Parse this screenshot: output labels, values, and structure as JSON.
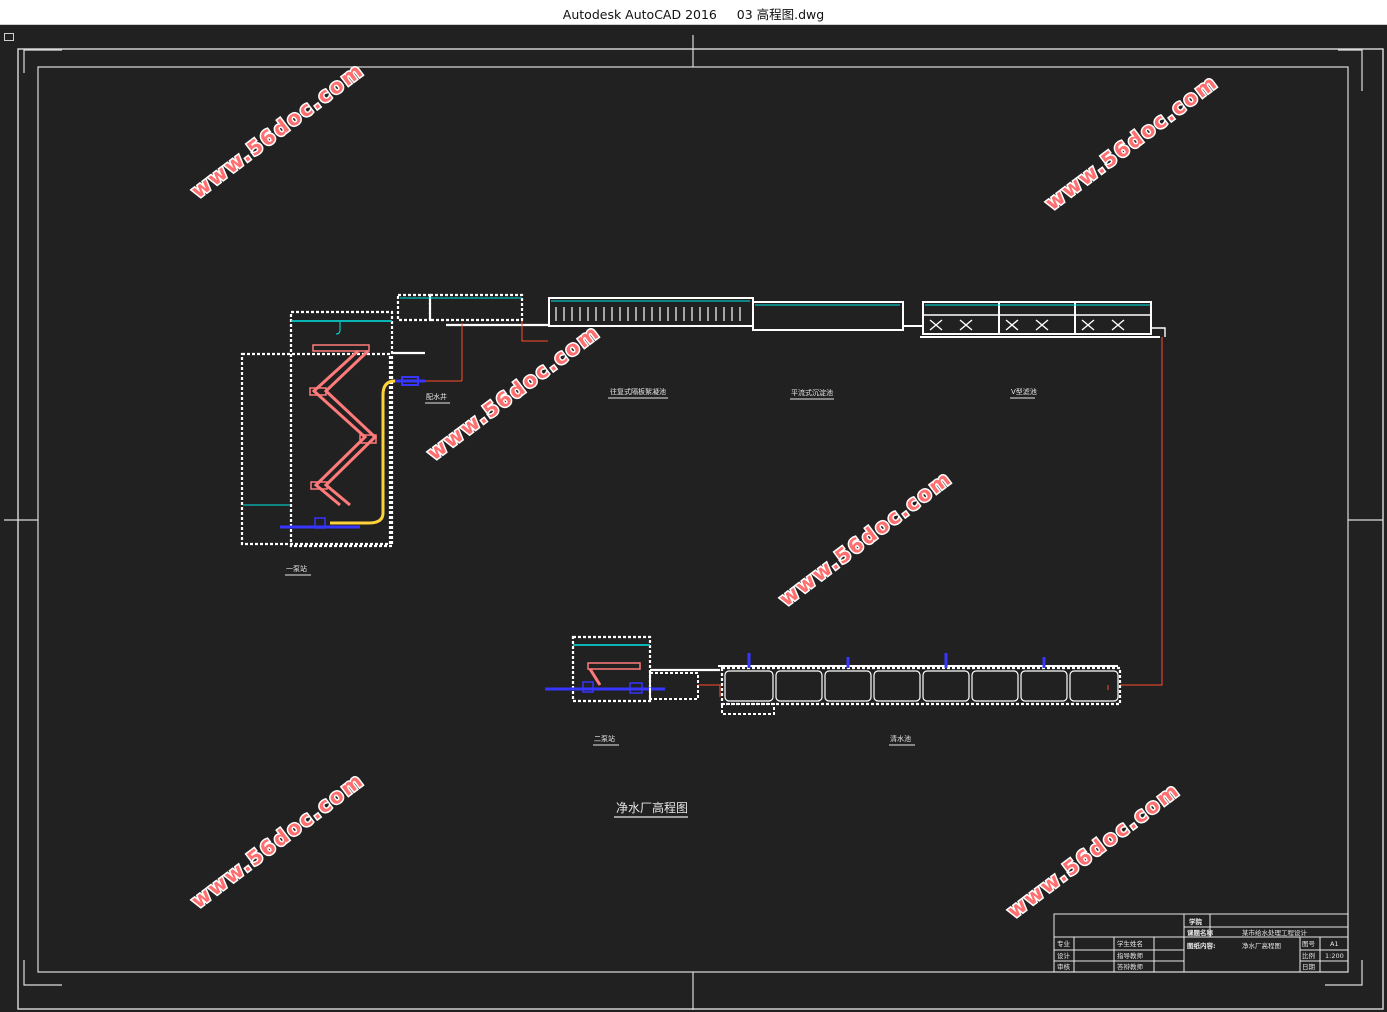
{
  "window": {
    "title": "Autodesk AutoCAD 2016     03 高程图.dwg"
  },
  "drawing": {
    "title": "净水厂高程图",
    "labels": {
      "pump1": "一泵站",
      "distribution_well": "配水井",
      "flocculation": "往复式隔板絮凝池",
      "sedimentation": "平流式沉淀池",
      "filter": "V型滤池",
      "pump2": "二泵站",
      "clear_well": "清水池"
    },
    "watermark": "www.56doc.com"
  },
  "title_block": {
    "school_label": "学院",
    "project_label": "课题名称",
    "project_value": "某市给水处理工程设计",
    "content_label": "图纸内容:",
    "content_value": "净水厂高程图",
    "sheet_label": "图号",
    "sheet_value": "A1",
    "scale_label": "比例",
    "scale_value": "1:200",
    "date_label": "日期",
    "row_labels": [
      "专业",
      "设计",
      "审核"
    ],
    "mid_labels": [
      "学生姓名",
      "指导教师",
      "答辩教师"
    ]
  },
  "colors": {
    "accent_line": "#ff4a2a",
    "pipe_blue": "#2a2aff",
    "pipe_yellow": "#ffd23a",
    "stair": "#ff7b7b",
    "water": "#00e5e5"
  }
}
